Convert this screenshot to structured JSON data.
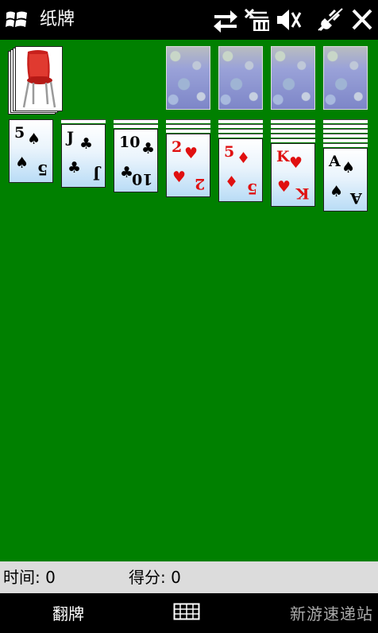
{
  "app": {
    "title": "纸牌"
  },
  "system_icons": [
    "sync-icon",
    "no-signal-icon",
    "volume-muted-icon",
    "power-plug-icon",
    "close-icon"
  ],
  "colors": {
    "felt": "#008000",
    "red_suit": "#e01010",
    "black_suit": "#000000"
  },
  "stock": {
    "image": "red chair",
    "depth": 3
  },
  "foundations": [
    {
      "state": "face-down"
    },
    {
      "state": "face-down"
    },
    {
      "state": "face-down"
    },
    {
      "state": "face-down"
    }
  ],
  "tableau": [
    {
      "hidden": 0,
      "top": {
        "rank": "5",
        "suit": "♠",
        "color": "black"
      }
    },
    {
      "hidden": 1,
      "top": {
        "rank": "J",
        "suit": "♣",
        "color": "black"
      }
    },
    {
      "hidden": 2,
      "top": {
        "rank": "10",
        "suit": "♣",
        "color": "black"
      }
    },
    {
      "hidden": 3,
      "top": {
        "rank": "2",
        "suit": "♥",
        "color": "red"
      }
    },
    {
      "hidden": 4,
      "top": {
        "rank": "5",
        "suit": "♦",
        "color": "red"
      }
    },
    {
      "hidden": 5,
      "top": {
        "rank": "K",
        "suit": "♥",
        "color": "red"
      }
    },
    {
      "hidden": 6,
      "top": {
        "rank": "A",
        "suit": "♠",
        "color": "black"
      }
    }
  ],
  "status": {
    "time_label": "时间: 0",
    "score_label": "得分: 0"
  },
  "softkeys": {
    "left": "翻牌",
    "menu_icon": "menu-grid-icon"
  },
  "watermark": "新游速递站"
}
